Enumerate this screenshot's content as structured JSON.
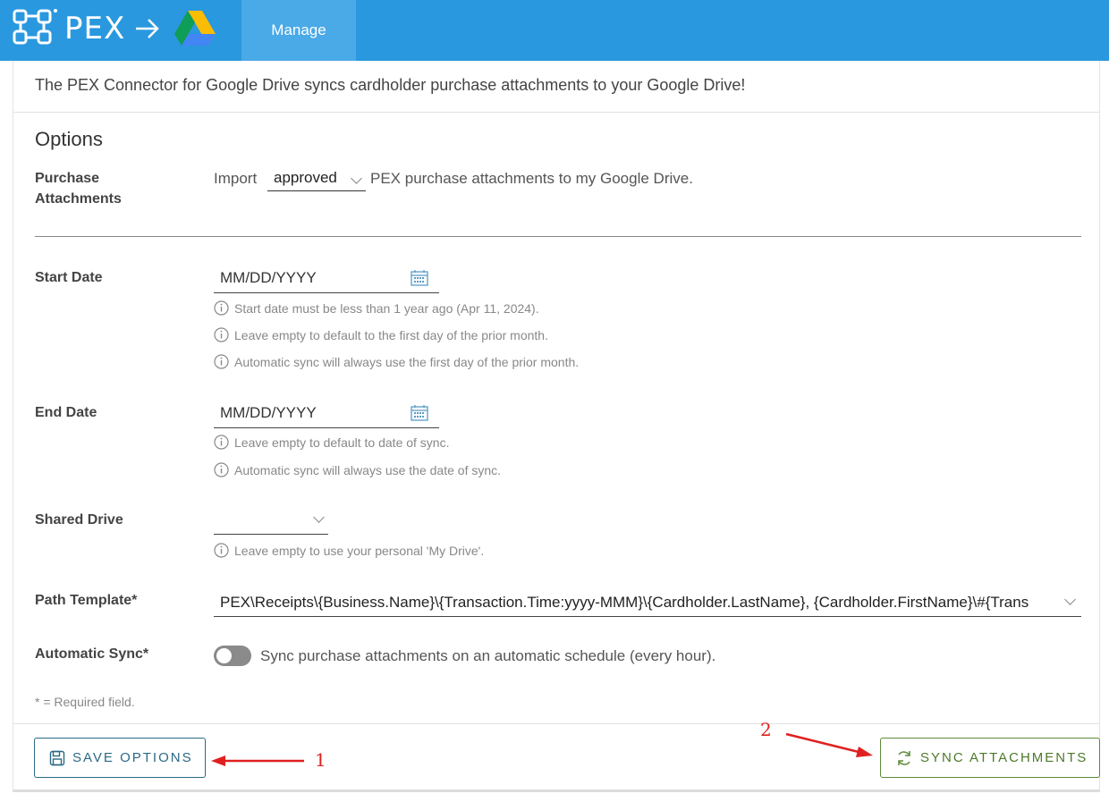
{
  "header": {
    "brand": "PEX",
    "tab_manage": "Manage"
  },
  "intro_text": "The PEX Connector for Google Drive syncs cardholder purchase attachments to your Google Drive!",
  "options": {
    "title": "Options",
    "purchase_attachments": {
      "label_line1": "Purchase",
      "label_line2": "Attachments",
      "prefix": "Import",
      "selected": "approved",
      "suffix": "PEX purchase attachments to my Google Drive."
    },
    "start_date": {
      "label": "Start Date",
      "placeholder": "MM/DD/YYYY",
      "hints": [
        "Start date must be less than 1 year ago (Apr 11, 2024).",
        "Leave empty to default to the first day of the prior month.",
        "Automatic sync will always use the first day of the prior month."
      ]
    },
    "end_date": {
      "label": "End Date",
      "placeholder": "MM/DD/YYYY",
      "hints": [
        "Leave empty to default to date of sync.",
        "Automatic sync will always use the date of sync."
      ]
    },
    "shared_drive": {
      "label": "Shared Drive",
      "value": "",
      "hint": "Leave empty to use your personal 'My Drive'."
    },
    "path_template": {
      "label": "Path Template*",
      "value": "PEX\\Receipts\\{Business.Name}\\{Transaction.Time:yyyy-MMM}\\{Cardholder.LastName}, {Cardholder.FirstName}\\#{Trans"
    },
    "automatic_sync": {
      "label": "Automatic Sync*",
      "enabled": false,
      "text": "Sync purchase attachments on an automatic schedule (every hour)."
    },
    "required_note": "* = Required field."
  },
  "buttons": {
    "save": "SAVE OPTIONS",
    "sync": "SYNC ATTACHMENTS"
  },
  "annotations": {
    "marker_1": "1",
    "marker_2": "2"
  },
  "colors": {
    "header_bg": "#2a98df",
    "tab_active_bg": "#4aa9e7",
    "save_button": "#2a6a86",
    "sync_button": "#5d8a3a",
    "annotation": "#e02020"
  }
}
